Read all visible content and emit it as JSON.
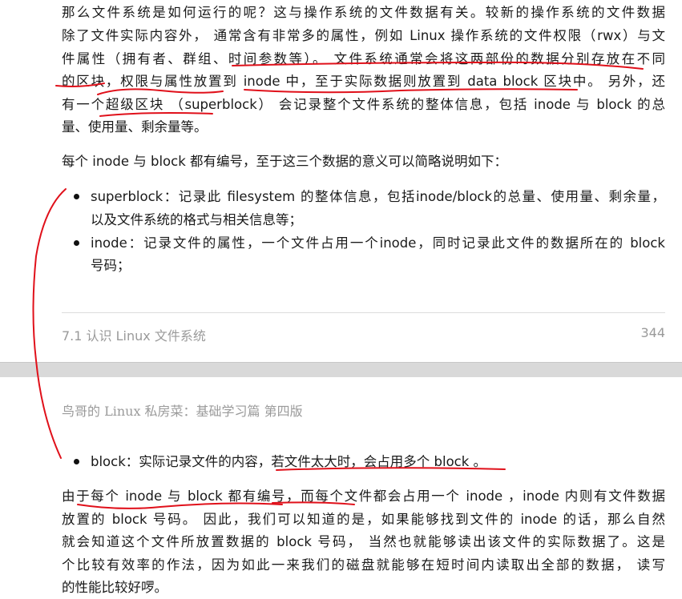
{
  "page1": {
    "paragraph1": [
      "那么文件系统是如何运行的呢？这与操作系统的文件数据有关。较新的操作系统的文件数据",
      "除了文件实际内容外， 通常含有非常多的属性，例如 Linux 操作系统的文件权限（rwx）与文",
      "件属性（拥有者、群组、时间参数等）。 文件系统通常会将这两部份的数据分别存放在不同",
      "的区块，权限与属性放置到 inode 中，至于实际数据则放置到 data block 区块中。 另外，还",
      "有一个超级区块 （superblock） 会记录整个文件系统的整体信息，包括 inode 与 block 的总",
      "量、使用量、剩余量等。"
    ],
    "paragraph2": "每个 inode 与 block 都有编号，至于这三个数据的意义可以简略说明如下：",
    "bullets": [
      {
        "lines": [
          "superblock：记录此 filesystem 的整体信息，包括inode/block的总量、使用量、剩余量，",
          "以及文件系统的格式与相关信息等；"
        ]
      },
      {
        "lines": [
          "inode：记录文件的属性，一个文件占用一个inode，同时记录此文件的数据所在的 block",
          "号码；"
        ]
      }
    ],
    "footer_section": "7.1 认识 Linux 文件系统",
    "footer_page": "344"
  },
  "page2": {
    "header": "鸟哥的 Linux 私房菜：基础学习篇 第四版",
    "bullet": "block：实际记录文件的内容，若文件太大时，会占用多个 block 。",
    "paragraph": [
      "由于每个 inode 与 block 都有编号，而每个文件都会占用一个 inode ，inode 内则有文件数据",
      "放置的 block 号码。 因此，我们可以知道的是，如果能够找到文件的 inode 的话，那么自然",
      "就会知道这个文件所放置数据的 block 号码， 当然也就能够读出该文件的实际数据了。这是",
      "个比较有效率的作法，因为如此一来我们的磁盘就能够在短时间内读取出全部的数据， 读写",
      "的性能比较好啰。"
    ]
  },
  "annotation_color": "#e0101a"
}
